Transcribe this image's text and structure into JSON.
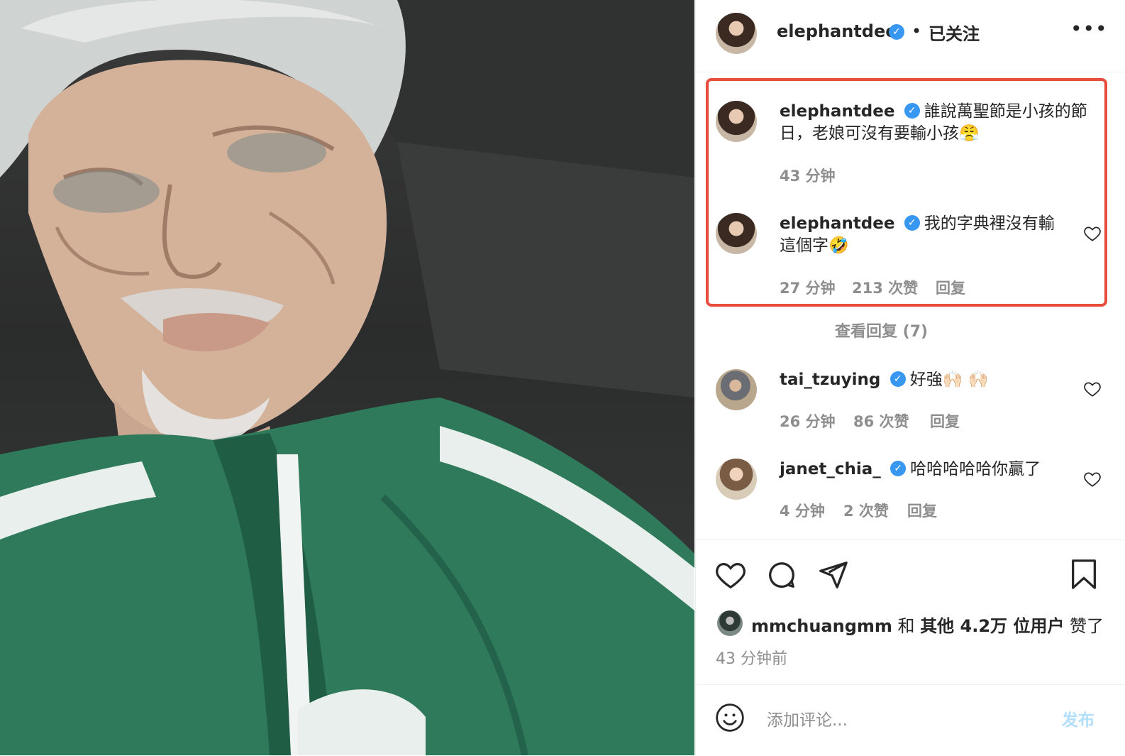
{
  "post": {
    "author": "elephantdee",
    "follow_status": "已关注",
    "separator": "•",
    "more_icon": "more-horizontal-icon",
    "verified_mark": "✓"
  },
  "comments": [
    {
      "user": "elephantdee",
      "text_line1": "誰說萬聖節是小孩的節",
      "text_line2": "日，老娘可沒有要輸小孩😤",
      "time": "43 分钟"
    },
    {
      "user": "elephantdee",
      "text_line1": "我的字典裡沒有輸",
      "text_line2": "這個字🤣",
      "time": "27 分钟",
      "likes": "213 次赞",
      "reply": "回复"
    },
    {
      "user": "tai_tzuying",
      "text_line1": "好強🙌🏻 🙌🏻",
      "time": "26 分钟",
      "likes": "86 次赞",
      "reply": "回复"
    },
    {
      "user": "janet_chia_",
      "text_line1": "哈哈哈哈哈你贏了",
      "time": "4 分钟",
      "likes": "2 次赞",
      "reply": "回复"
    }
  ],
  "view_replies": "查看回复 (7)",
  "liked_by": {
    "user": "mmchuangmm",
    "and": "和",
    "others": "其他 4.2万 位用户",
    "suffix": "赞了"
  },
  "time_ago": "43 分钟前",
  "add_comment": {
    "placeholder": "添加评论...",
    "post_label": "发布"
  },
  "icons": {
    "like": "heart-icon",
    "comment": "comment-icon",
    "share": "send-icon",
    "save": "bookmark-icon",
    "emoji": "emoji-icon"
  },
  "colors": {
    "highlight_box": "#e74c3c",
    "verified": "#3897f0",
    "post_button": "#b2dffc",
    "muted_text": "#8e8e8e"
  }
}
